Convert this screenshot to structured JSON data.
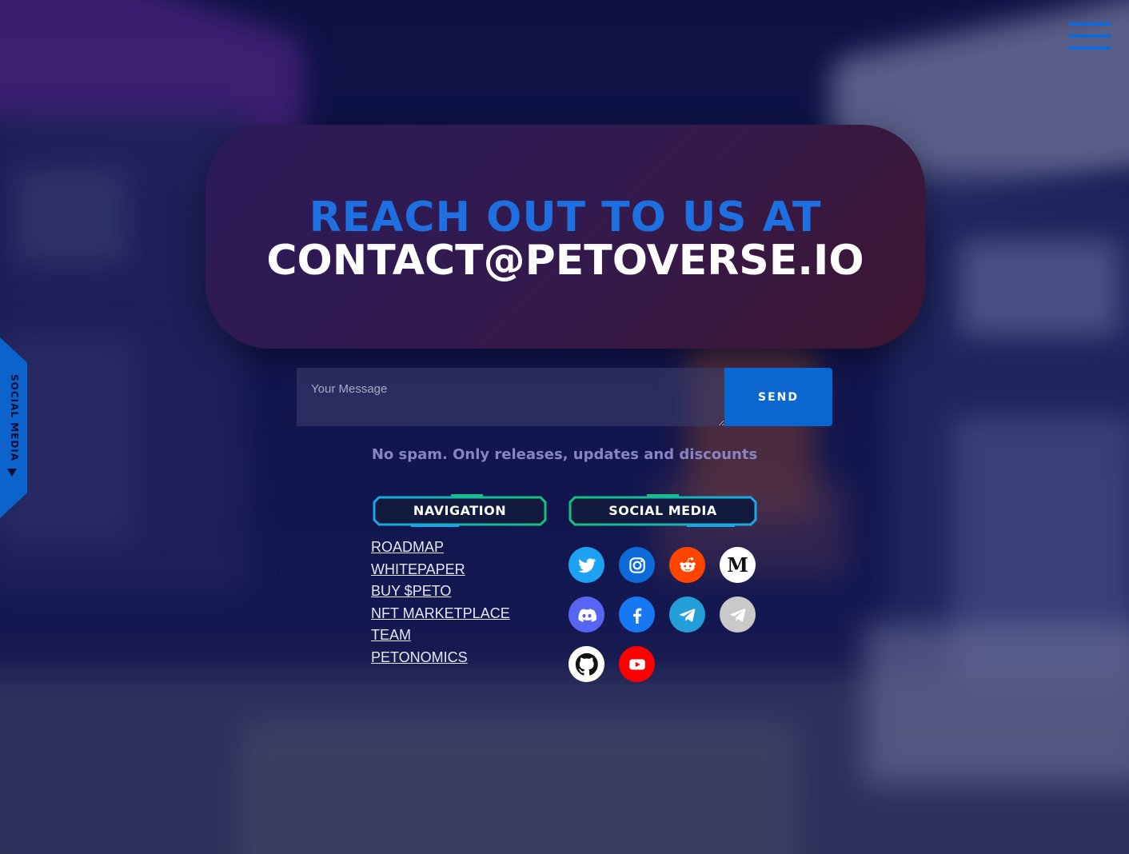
{
  "page": {
    "heading_line1": "REACH OUT TO US AT",
    "heading_line2": "CONTACT@PETOVERSE.IO"
  },
  "side_tab": {
    "label": "SOCIAL MEDIA"
  },
  "menu": {
    "icon": "hamburger-icon"
  },
  "form": {
    "placeholder": "Your Message",
    "value": "",
    "send_label": "SEND",
    "note": "No spam. Only releases, updates and discounts"
  },
  "navigation": {
    "title": "NAVIGATION",
    "links": [
      "ROADMAP",
      "WHITEPAPER",
      "BUY $PETO",
      "NFT MARKETPLACE",
      "TEAM",
      "PETONOMICS"
    ]
  },
  "social_media": {
    "title": "SOCIAL MEDIA",
    "icons": [
      {
        "name": "twitter-icon",
        "color": "#1da1f2"
      },
      {
        "name": "instagram-icon",
        "color": "#0e6ad8"
      },
      {
        "name": "reddit-icon",
        "color": "#ff4500"
      },
      {
        "name": "medium-icon",
        "color": "#ffffff"
      },
      {
        "name": "discord-icon",
        "color": "#5865f2"
      },
      {
        "name": "facebook-icon",
        "color": "#1877f2"
      },
      {
        "name": "telegram-icon",
        "color": "#229ed9"
      },
      {
        "name": "telegram-gray-icon",
        "color": "#c9c9c9"
      },
      {
        "name": "github-icon",
        "color": "#ffffff"
      },
      {
        "name": "youtube-icon",
        "color": "#ff0000"
      }
    ]
  },
  "colors": {
    "accent": "#0e6ad8",
    "heading_blue": "#1e6fe0",
    "note_purple": "#8a84c4"
  }
}
